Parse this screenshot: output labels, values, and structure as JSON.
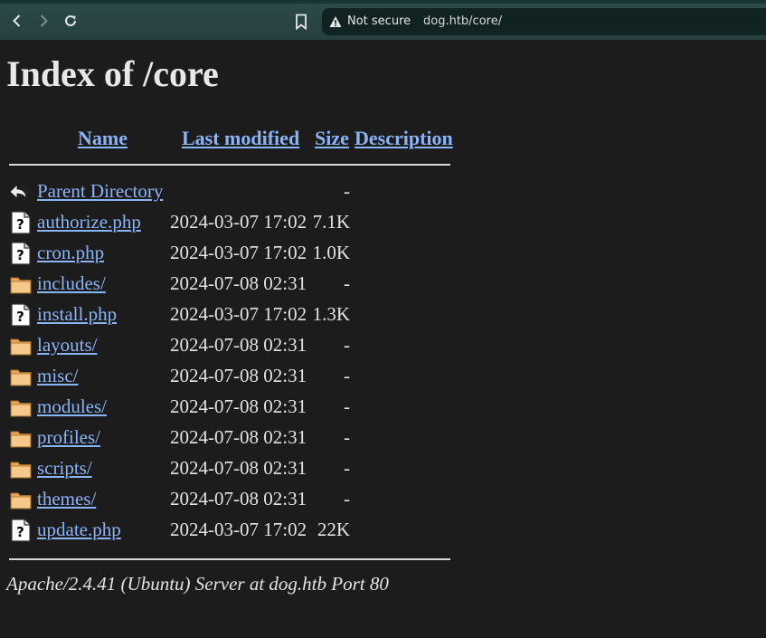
{
  "browser": {
    "security_label": "Not secure",
    "url": "dog.htb/core/"
  },
  "page": {
    "title": "Index of /core",
    "columns": {
      "name": "Name",
      "last_modified": "Last modified",
      "size": "Size",
      "description": "Description"
    },
    "rows": [
      {
        "icon": "back-icon",
        "name": "Parent Directory",
        "date": "",
        "size": "-"
      },
      {
        "icon": "unknown-file-icon",
        "name": "authorize.php",
        "date": "2024-03-07 17:02",
        "size": "7.1K"
      },
      {
        "icon": "unknown-file-icon",
        "name": "cron.php",
        "date": "2024-03-07 17:02",
        "size": "1.0K"
      },
      {
        "icon": "folder-icon",
        "name": "includes/",
        "date": "2024-07-08 02:31",
        "size": "-"
      },
      {
        "icon": "unknown-file-icon",
        "name": "install.php",
        "date": "2024-03-07 17:02",
        "size": "1.3K"
      },
      {
        "icon": "folder-icon",
        "name": "layouts/",
        "date": "2024-07-08 02:31",
        "size": "-"
      },
      {
        "icon": "folder-icon",
        "name": "misc/",
        "date": "2024-07-08 02:31",
        "size": "-"
      },
      {
        "icon": "folder-icon",
        "name": "modules/",
        "date": "2024-07-08 02:31",
        "size": "-"
      },
      {
        "icon": "folder-icon",
        "name": "profiles/",
        "date": "2024-07-08 02:31",
        "size": "-"
      },
      {
        "icon": "folder-icon",
        "name": "scripts/",
        "date": "2024-07-08 02:31",
        "size": "-"
      },
      {
        "icon": "folder-icon",
        "name": "themes/",
        "date": "2024-07-08 02:31",
        "size": "-"
      },
      {
        "icon": "unknown-file-icon",
        "name": "update.php",
        "date": "2024-03-07 17:02",
        "size": "22K"
      }
    ],
    "footer": "Apache/2.4.41 (Ubuntu) Server at dog.htb Port 80"
  },
  "colors": {
    "background": "#1c1c1c",
    "link": "#8ab4f8",
    "text": "#e3e3e3",
    "toolbar": "#2c4a4a"
  }
}
